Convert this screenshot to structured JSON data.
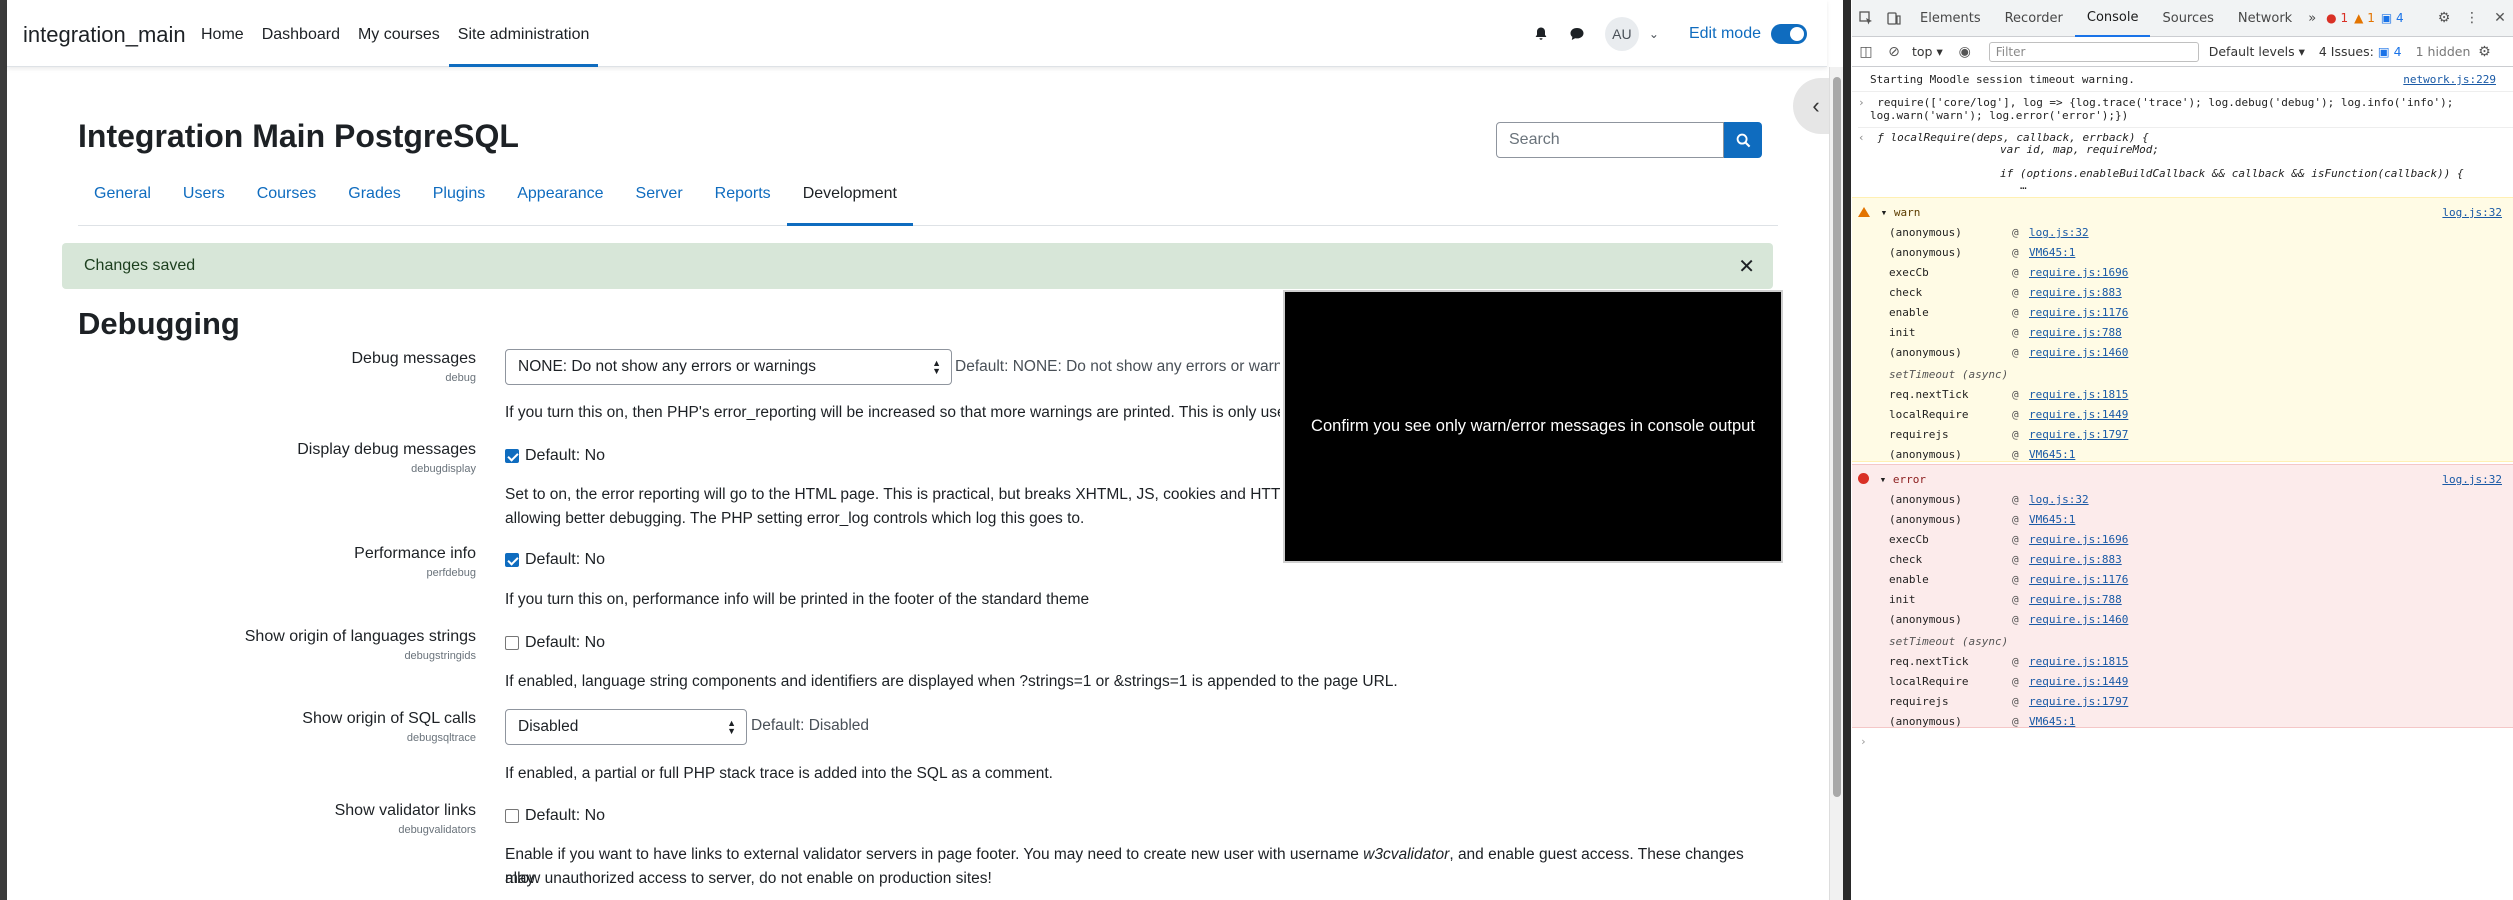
{
  "navbar": {
    "brand": "integration_main",
    "links": [
      "Home",
      "Dashboard",
      "My courses",
      "Site administration"
    ],
    "avatar": "AU",
    "edit_mode": "Edit mode"
  },
  "page": {
    "title": "Integration Main PostgreSQL",
    "search_placeholder": "Search",
    "tabs": [
      "General",
      "Users",
      "Courses",
      "Grades",
      "Plugins",
      "Appearance",
      "Server",
      "Reports",
      "Development"
    ],
    "alert": "Changes saved",
    "section_title": "Debugging"
  },
  "settings": {
    "debug": {
      "label": "Debug messages",
      "id": "debug",
      "select_value": "NONE: Do not show any errors or warnings",
      "default": "Default: NONE: Do not show any errors or warnin",
      "desc": "If you turn this on, then PHP's error_reporting will be increased so that more warnings are printed. This is only useful f"
    },
    "debugdisplay": {
      "label": "Display debug messages",
      "id": "debugdisplay",
      "checked": true,
      "cb_label": "Default: No",
      "desc1": "Set to on, the error reporting will go to the HTML page. This is practical, but breaks XHTML, JS, cookies and HTTP he",
      "desc2": "allowing better debugging. The PHP setting error_log controls which log this goes to."
    },
    "perfdebug": {
      "label": "Performance info",
      "id": "perfdebug",
      "checked": true,
      "cb_label": "Default: No",
      "desc": "If you turn this on, performance info will be printed in the footer of the standard theme"
    },
    "debugstringids": {
      "label": "Show origin of languages strings",
      "id": "debugstringids",
      "checked": false,
      "cb_label": "Default: No",
      "desc": "If enabled, language string components and identifiers are displayed when ?strings=1 or &strings=1 is appended to the page URL."
    },
    "debugsqltrace": {
      "label": "Show origin of SQL calls",
      "id": "debugsqltrace",
      "select_value": "Disabled",
      "default": "Default: Disabled",
      "desc": "If enabled, a partial or full PHP stack trace is added into the SQL as a comment."
    },
    "debugvalidators": {
      "label": "Show validator links",
      "id": "debugvalidators",
      "checked": false,
      "cb_label": "Default: No",
      "desc1_pre": "Enable if you want to have links to external validator servers in page footer. You may need to create new user with username ",
      "desc1_em": "w3cvalidator",
      "desc1_post": ", and enable guest access. These changes may",
      "desc2": "allow unauthorized access to server, do not enable on production sites!"
    }
  },
  "overlay": {
    "message": "Confirm you see only warn/error messages in console output"
  },
  "devtools": {
    "tabs": [
      "Elements",
      "Recorder",
      "Console",
      "Sources",
      "Network"
    ],
    "active_tab": "Console",
    "more": "»",
    "errors_count": "1",
    "warnings_count": "1",
    "info_count": "4",
    "context": "top",
    "filter_placeholder": "Filter",
    "levels": "Default levels",
    "issues": "4 Issues:",
    "issues_count": "4",
    "hidden": "1 hidden",
    "console": {
      "line1": "Starting Moodle session timeout warning.",
      "line1_src": "network.js:229",
      "cmd1": "require(['core/log'], log => {log.trace('trace'); log.debug('debug'); log.info('info');",
      "cmd2": "log.warn('warn'); log.error('error');})",
      "ret1": "ƒ localRequire(deps, callback, errback) {",
      "ret2": "var id, map, requireMod;",
      "ret3": "if (options.enableBuildCallback && callback && isFunction(callback)) {",
      "ret4": "…",
      "warn_label": "warn",
      "error_label": "error",
      "src": "log.js:32",
      "async": "setTimeout (async)",
      "frames_top": [
        {
          "fn": "(anonymous)",
          "loc": "log.js:32"
        },
        {
          "fn": "(anonymous)",
          "loc": "VM645:1"
        },
        {
          "fn": "execCb",
          "loc": "require.js:1696"
        },
        {
          "fn": "check",
          "loc": "require.js:883"
        },
        {
          "fn": "enable",
          "loc": "require.js:1176"
        },
        {
          "fn": "init",
          "loc": "require.js:788"
        },
        {
          "fn": "(anonymous)",
          "loc": "require.js:1460"
        }
      ],
      "frames_bottom": [
        {
          "fn": "req.nextTick",
          "loc": "require.js:1815"
        },
        {
          "fn": "localRequire",
          "loc": "require.js:1449"
        },
        {
          "fn": "requirejs",
          "loc": "require.js:1797"
        },
        {
          "fn": "(anonymous)",
          "loc": "VM645:1"
        }
      ]
    }
  }
}
